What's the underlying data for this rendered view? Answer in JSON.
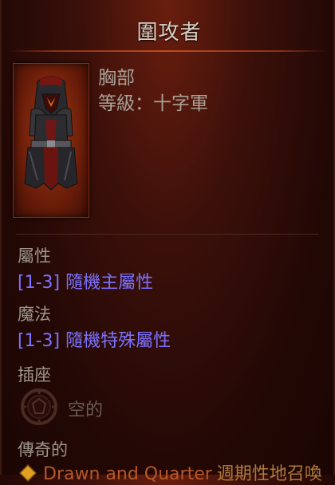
{
  "tooltip": {
    "item_name": "圍攻者",
    "slot_type": "胸部",
    "class_requirement": "等級：十字軍",
    "sections": {
      "attributes_heading": "屬性",
      "attributes_affix": "[1-3] 隨機主屬性",
      "magic_heading": "魔法",
      "magic_affix": "[1-3] 隨機特殊屬性",
      "sockets_heading": "插座",
      "socket_empty": "空的",
      "legendary_heading": "傳奇的",
      "legendary_power_name": "Drawn and Quarter",
      "legendary_power_desc": "週期性地召喚"
    }
  },
  "colors": {
    "background": "#3c100a",
    "affix_text": "#7c72ff",
    "legendary_name": "#b5582a",
    "title_text": "#d8cfc4"
  },
  "icons": {
    "item_portrait": "chest-armor-icon",
    "socket": "empty-socket-icon",
    "legendary": "legendary-power-icon"
  }
}
